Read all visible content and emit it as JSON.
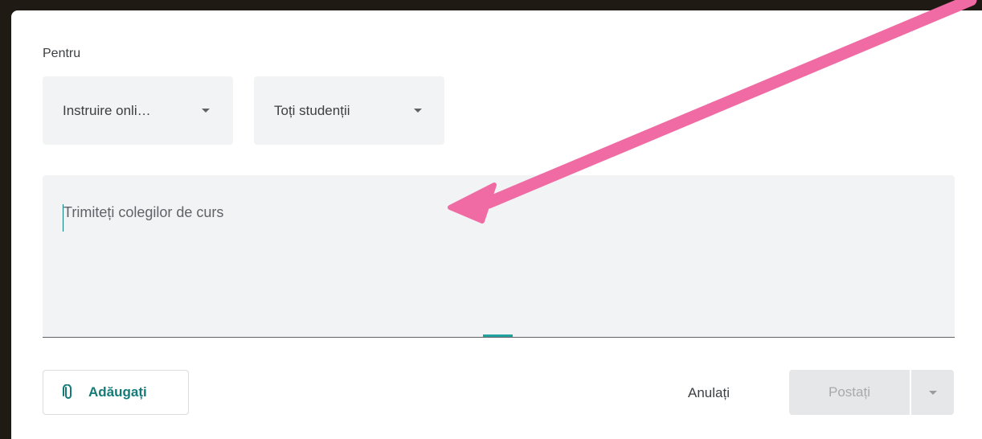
{
  "audience": {
    "label": "Pentru",
    "class_dropdown": {
      "value": "Instruire onli…",
      "icon": "caret-down-icon"
    },
    "students_dropdown": {
      "value": "Toți studenții",
      "icon": "caret-down-icon"
    }
  },
  "composer": {
    "placeholder": "Trimiteți colegilor de curs",
    "value": ""
  },
  "actions": {
    "add_label": "Adăugați",
    "add_icon": "paperclip-icon",
    "cancel_label": "Anulați",
    "post_label": "Postați",
    "post_more_icon": "caret-down-icon",
    "post_enabled": false
  },
  "annotation": {
    "type": "arrow",
    "color": "#f06aa3"
  },
  "colors": {
    "accent": "#137b78",
    "focus_underline": "#22a3a0",
    "field_background": "#f1f3f4",
    "disabled_button": "#e6e7e8",
    "backdrop": "#1f1a14"
  }
}
